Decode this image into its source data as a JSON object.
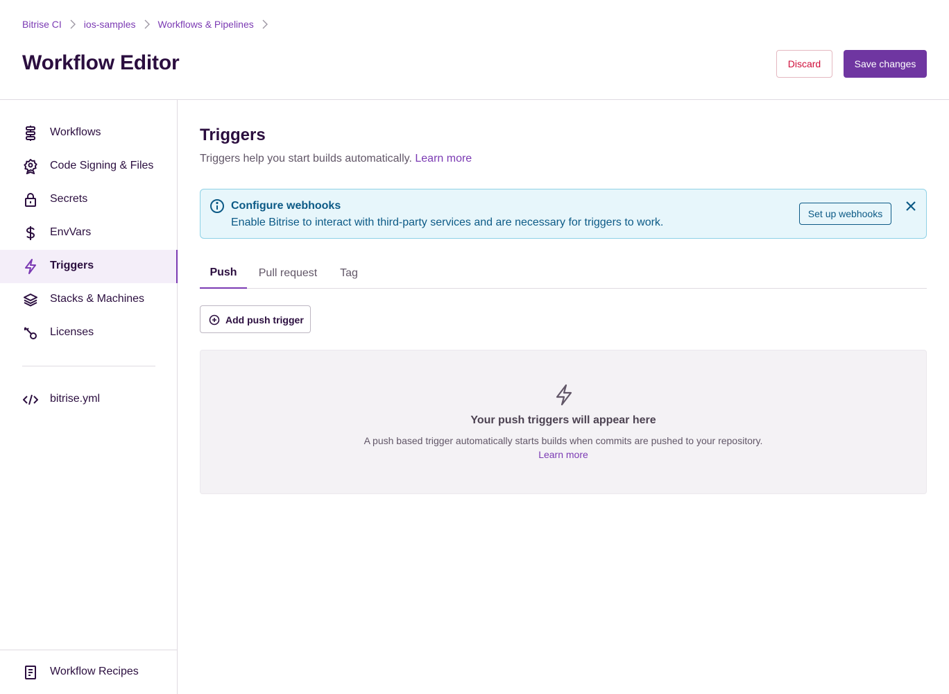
{
  "breadcrumb": [
    "Bitrise CI",
    "ios-samples",
    "Workflows & Pipelines"
  ],
  "header": {
    "title": "Workflow Editor",
    "discard_label": "Discard",
    "save_label": "Save changes"
  },
  "sidebar": {
    "items": [
      {
        "label": "Workflows",
        "icon": "workflows-icon"
      },
      {
        "label": "Code Signing & Files",
        "icon": "badge-icon"
      },
      {
        "label": "Secrets",
        "icon": "lock-icon"
      },
      {
        "label": "EnvVars",
        "icon": "dollar-icon"
      },
      {
        "label": "Triggers",
        "icon": "lightning-icon",
        "active": true
      },
      {
        "label": "Stacks & Machines",
        "icon": "layers-icon"
      },
      {
        "label": "Licenses",
        "icon": "key-icon"
      }
    ],
    "yml_item": {
      "label": "bitrise.yml",
      "icon": "code-icon"
    },
    "bottom_item": {
      "label": "Workflow Recipes",
      "icon": "document-icon"
    }
  },
  "main": {
    "title": "Triggers",
    "description": "Triggers help you start builds automatically.",
    "learn_more": "Learn more",
    "notice": {
      "title": "Configure webhooks",
      "text": "Enable Bitrise to interact with third-party services and are necessary for triggers to work.",
      "button": "Set up webhooks"
    },
    "tabs": [
      {
        "label": "Push",
        "active": true
      },
      {
        "label": "Pull request"
      },
      {
        "label": "Tag"
      }
    ],
    "add_button": "Add push trigger",
    "empty_state": {
      "title": "Your push triggers will appear here",
      "text": "A push based trigger automatically starts builds when commits are pushed to your repository.",
      "link": "Learn more"
    }
  },
  "colors": {
    "accent": "#7b3ab3",
    "primary_button": "#6f36a1",
    "danger": "#cf0e3a",
    "info": "#0c5a86",
    "info_bg": "#e7f6fb"
  }
}
